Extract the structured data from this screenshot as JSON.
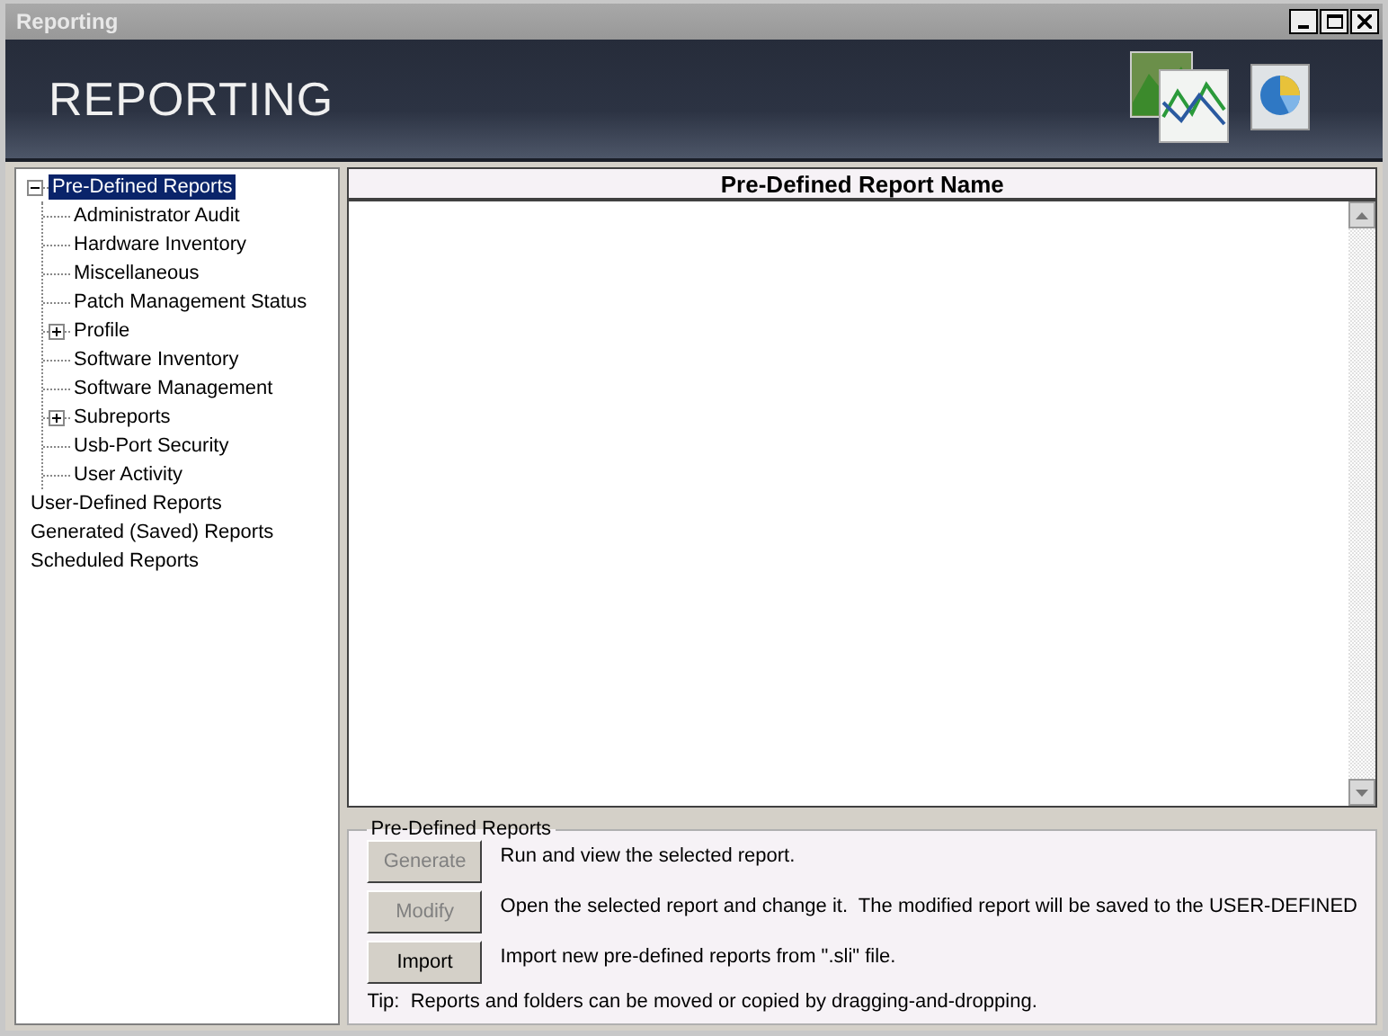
{
  "window": {
    "title": "Reporting"
  },
  "banner": {
    "title": "REPORTING"
  },
  "tree": [
    {
      "label": "Pre-Defined Reports",
      "selected": true,
      "expanded": true,
      "children": [
        {
          "label": "Administrator Audit",
          "selected": false
        },
        {
          "label": "Hardware Inventory",
          "selected": false
        },
        {
          "label": "Miscellaneous",
          "selected": false
        },
        {
          "label": "Patch Management Status",
          "selected": false
        },
        {
          "label": "Profile",
          "selected": false,
          "expanded": false
        },
        {
          "label": "Software Inventory",
          "selected": false
        },
        {
          "label": "Software Management",
          "selected": false
        },
        {
          "label": "Subreports",
          "selected": false,
          "expanded": false
        },
        {
          "label": "Usb-Port Security",
          "selected": false
        },
        {
          "label": "User Activity",
          "selected": false
        }
      ]
    },
    {
      "label": "User-Defined Reports",
      "selected": false
    },
    {
      "label": "Generated (Saved) Reports",
      "selected": false
    },
    {
      "label": "Scheduled Reports",
      "selected": false
    }
  ],
  "list": {
    "column": "Pre-Defined Report Name"
  },
  "actions": {
    "title": "Pre-Defined Reports",
    "items": [
      {
        "button": "Generate",
        "disabled": true,
        "description": "Run and view the selected report."
      },
      {
        "button": "Modify",
        "disabled": true,
        "description": "Open the selected report and change it.  The modified report will be saved to the USER-DEFINED"
      },
      {
        "button": "Import",
        "disabled": false,
        "description": "Import new pre-defined reports from \".sli\" file."
      }
    ],
    "tip": "Tip:  Reports and folders can be moved or copied by dragging-and-dropping."
  }
}
